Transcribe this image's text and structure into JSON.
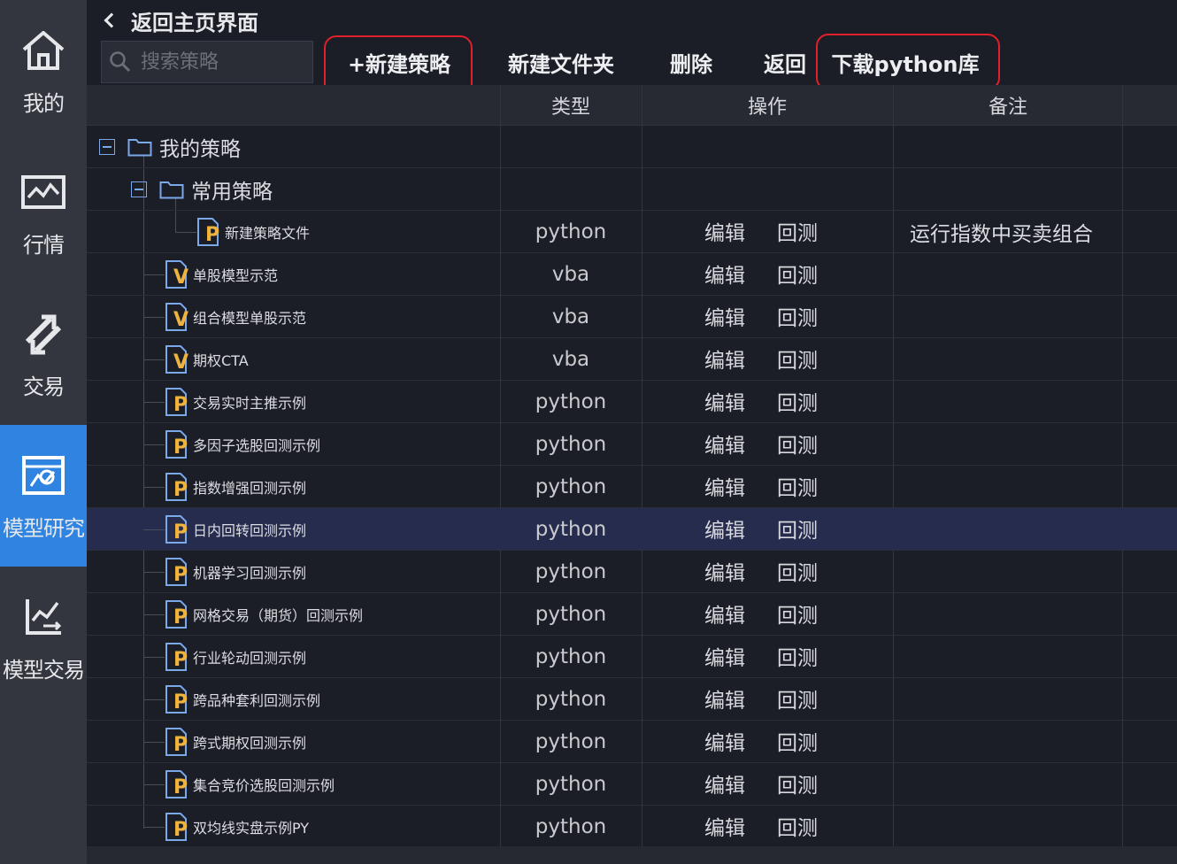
{
  "sidebar": {
    "items": [
      {
        "label": "我的",
        "icon": "home-icon"
      },
      {
        "label": "行情",
        "icon": "chart-icon"
      },
      {
        "label": "交易",
        "icon": "trade-arrows-icon"
      },
      {
        "label": "模型研究",
        "icon": "model-research-icon",
        "active": true
      },
      {
        "label": "模型交易",
        "icon": "model-trade-icon"
      }
    ],
    "active_color": "#2e84e0"
  },
  "header": {
    "back_label": "返回主页界面",
    "search_placeholder": "搜索策略",
    "buttons": {
      "new_strategy": "+新建策略",
      "new_folder": "新建文件夹",
      "delete": "删除",
      "back": "返回",
      "download": "下载python库"
    },
    "highlight_color": "#e0202a"
  },
  "table": {
    "columns": {
      "type": "类型",
      "action": "操作",
      "remark": "备注"
    },
    "actions": {
      "edit": "编辑",
      "backtest": "回测"
    },
    "folders": [
      {
        "name": "我的策略"
      },
      {
        "name": "常用策略"
      }
    ],
    "rows": [
      {
        "name": "新建策略文件",
        "type": "python",
        "remark": "运行指数中买卖组合",
        "file_icon": "P"
      },
      {
        "name": "单股模型示范",
        "type": "vba",
        "remark": "",
        "file_icon": "V"
      },
      {
        "name": "组合模型单股示范",
        "type": "vba",
        "remark": "",
        "file_icon": "V"
      },
      {
        "name": "期权CTA",
        "type": "vba",
        "remark": "",
        "file_icon": "V"
      },
      {
        "name": "交易实时主推示例",
        "type": "python",
        "remark": "",
        "file_icon": "P"
      },
      {
        "name": "多因子选股回测示例",
        "type": "python",
        "remark": "",
        "file_icon": "P"
      },
      {
        "name": "指数增强回测示例",
        "type": "python",
        "remark": "",
        "file_icon": "P"
      },
      {
        "name": "日内回转回测示例",
        "type": "python",
        "remark": "",
        "file_icon": "P",
        "selected": true
      },
      {
        "name": "机器学习回测示例",
        "type": "python",
        "remark": "",
        "file_icon": "P"
      },
      {
        "name": "网格交易（期货）回测示例",
        "type": "python",
        "remark": "",
        "file_icon": "P"
      },
      {
        "name": "行业轮动回测示例",
        "type": "python",
        "remark": "",
        "file_icon": "P"
      },
      {
        "name": "跨品种套利回测示例",
        "type": "python",
        "remark": "",
        "file_icon": "P"
      },
      {
        "name": "跨式期权回测示例",
        "type": "python",
        "remark": "",
        "file_icon": "P"
      },
      {
        "name": "集合竞价选股回测示例",
        "type": "python",
        "remark": "",
        "file_icon": "P"
      },
      {
        "name": "双均线实盘示例PY",
        "type": "python",
        "remark": "",
        "file_icon": "P"
      }
    ]
  }
}
